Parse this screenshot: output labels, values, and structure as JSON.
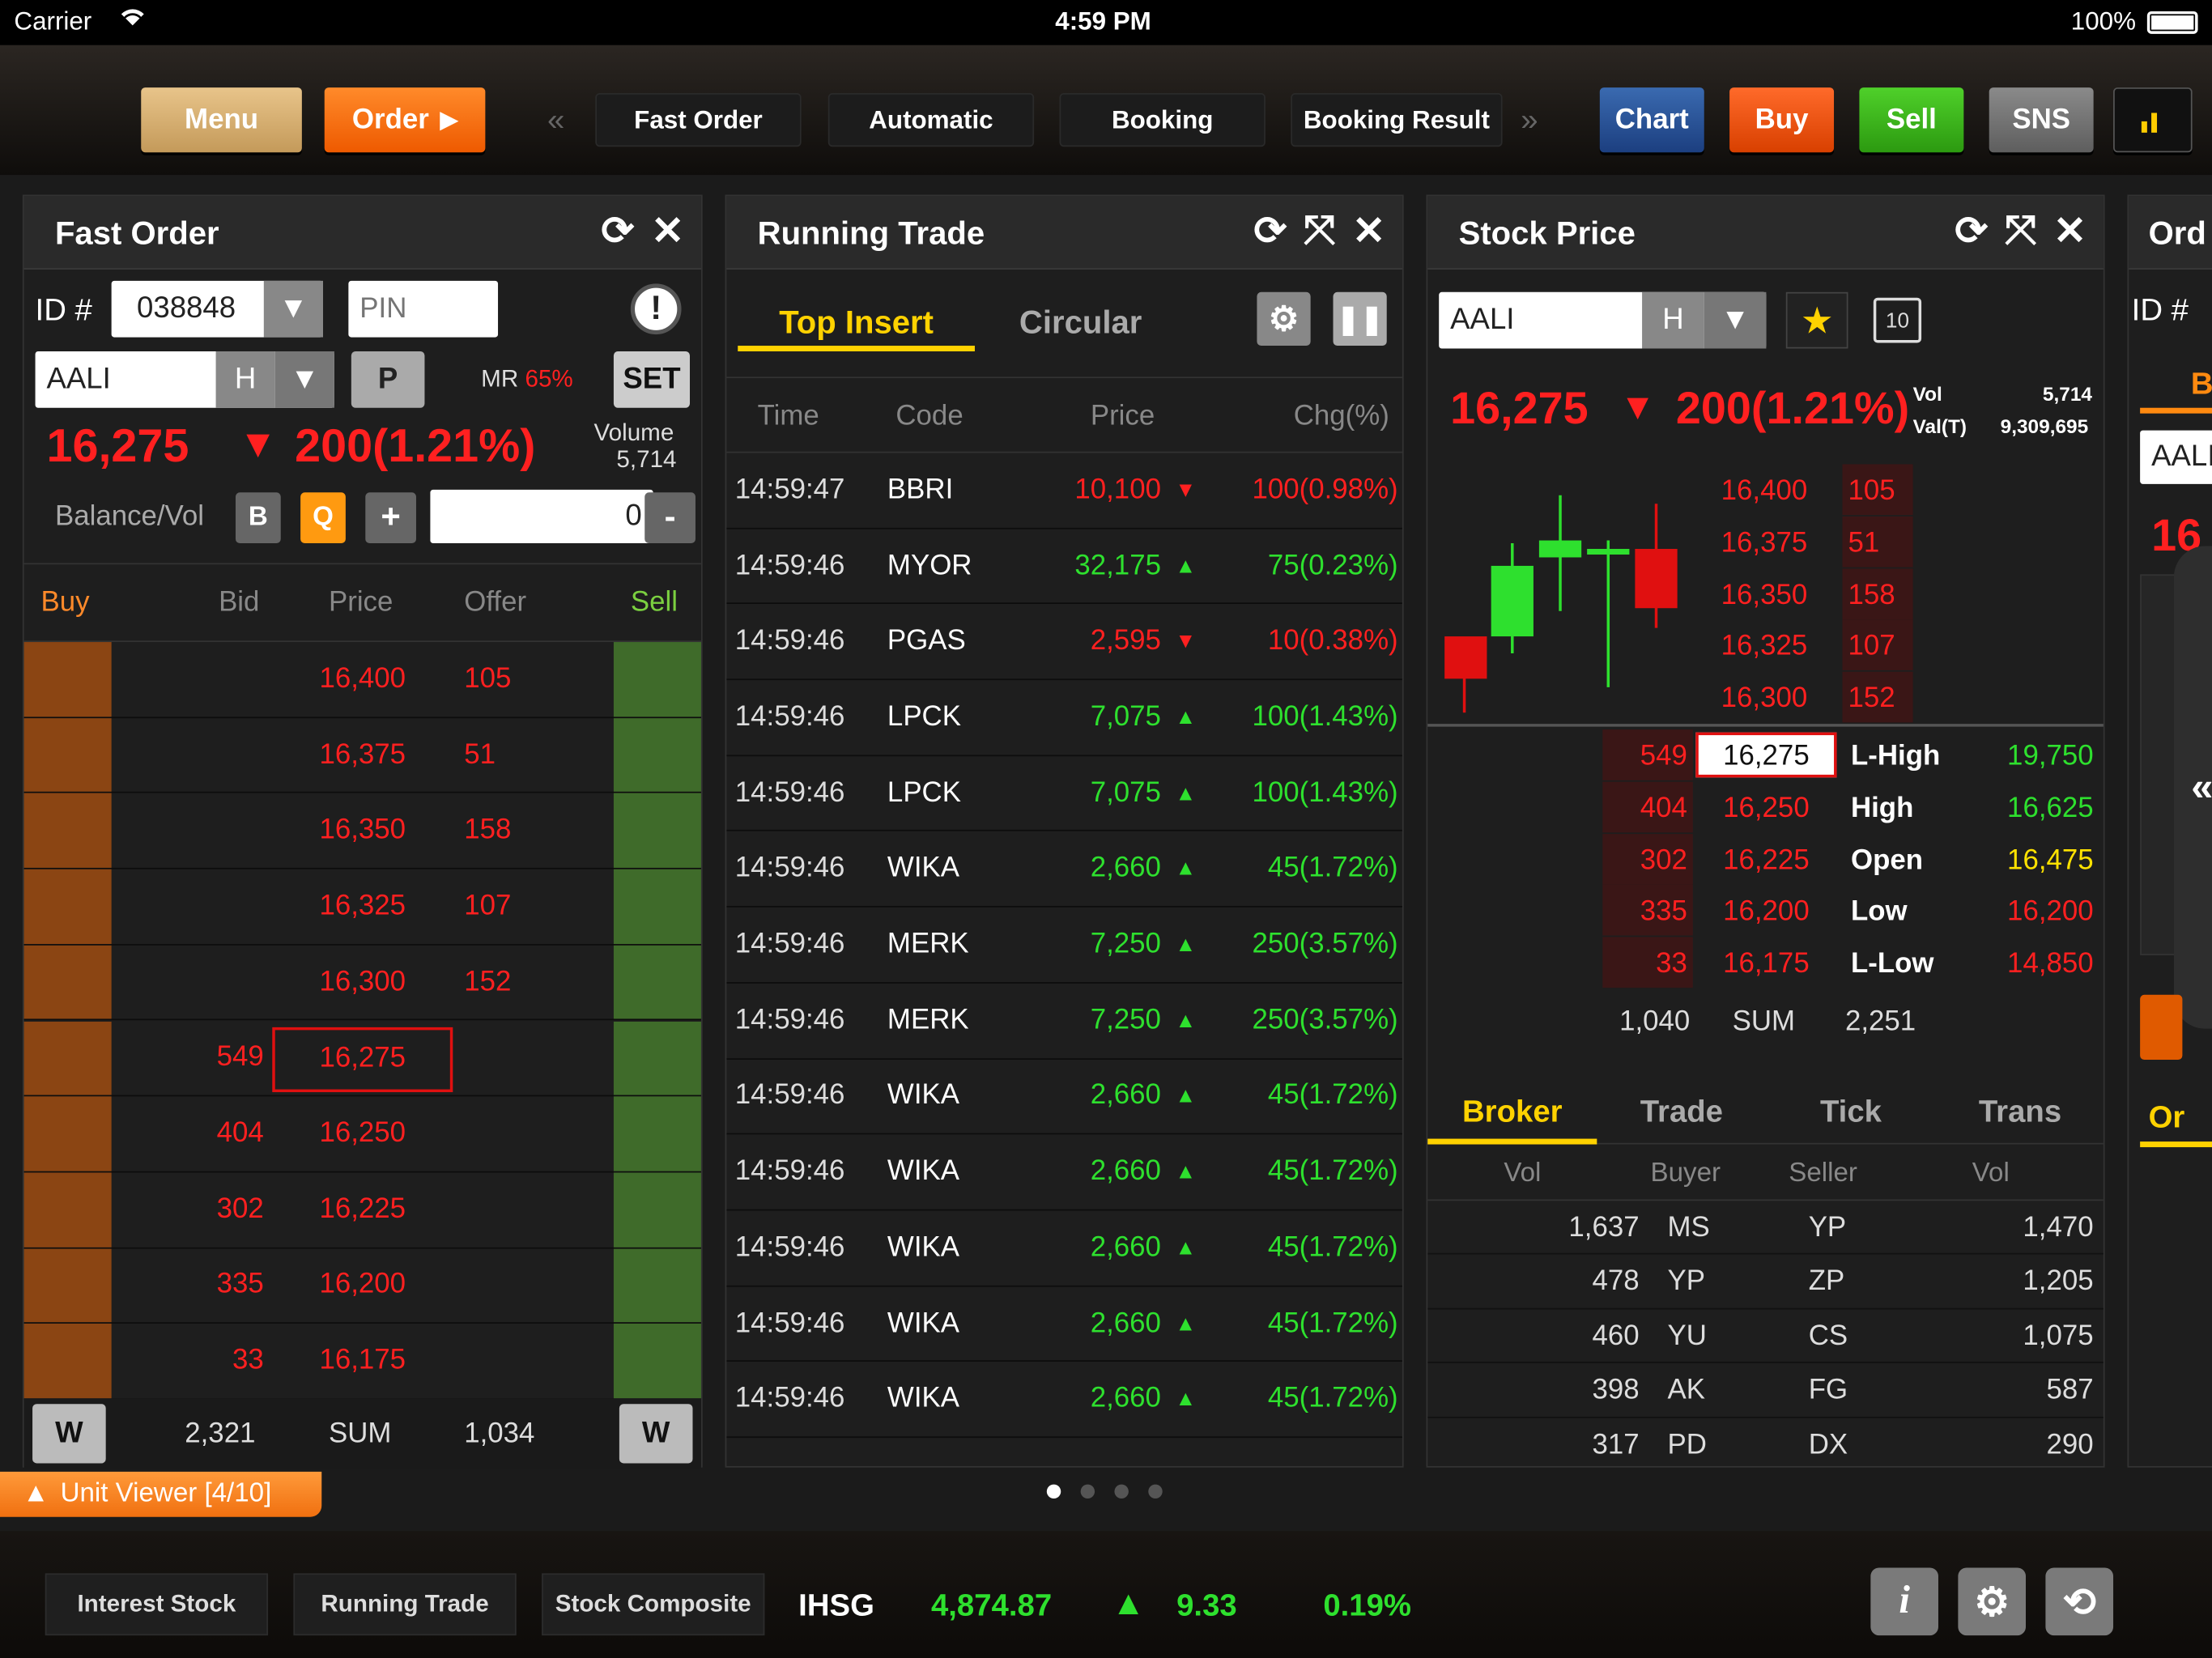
{
  "status": {
    "carrier": "Carrier",
    "time": "4:59 PM",
    "battery": "100%"
  },
  "nav": {
    "menu": "Menu",
    "order": "Order",
    "tabs": [
      "Fast Order",
      "Automatic",
      "Booking",
      "Booking Result"
    ],
    "chart": "Chart",
    "buy": "Buy",
    "sell": "Sell",
    "sns": "SNS"
  },
  "colors": {
    "accent": "#ff6600",
    "buy_bar": "#8b4513",
    "sell_bar": "#3f6b2a",
    "up": "#2ee02e",
    "down": "#ff2020"
  },
  "fast_order": {
    "title": "Fast Order",
    "id_label": "ID #",
    "id_value": "038848",
    "pin_placeholder": "PIN",
    "code": "AALI",
    "board": "H",
    "p_btn": "P",
    "mr_label": "MR",
    "mr_value": "65%",
    "set_btn": "SET",
    "price": "16,275",
    "change": "200(1.21%)",
    "volume_label": "Volume",
    "volume_value": "5,714",
    "balance_label": "Balance/Vol",
    "b_btn": "B",
    "q_btn": "Q",
    "plus": "+",
    "qty": "0",
    "minus": "-",
    "headers": {
      "buy": "Buy",
      "bid": "Bid",
      "price": "Price",
      "offer": "Offer",
      "sell": "Sell"
    },
    "rows": [
      {
        "bid": "",
        "price": "16,400",
        "offer": "105"
      },
      {
        "bid": "",
        "price": "16,375",
        "offer": "51"
      },
      {
        "bid": "",
        "price": "16,350",
        "offer": "158"
      },
      {
        "bid": "",
        "price": "16,325",
        "offer": "107"
      },
      {
        "bid": "",
        "price": "16,300",
        "offer": "152"
      },
      {
        "bid": "549",
        "price": "16,275",
        "offer": ""
      },
      {
        "bid": "404",
        "price": "16,250",
        "offer": ""
      },
      {
        "bid": "302",
        "price": "16,225",
        "offer": ""
      },
      {
        "bid": "335",
        "price": "16,200",
        "offer": ""
      },
      {
        "bid": "33",
        "price": "16,175",
        "offer": ""
      }
    ],
    "w_btn": "W",
    "sum_bid": "2,321",
    "sum_label": "SUM",
    "sum_offer": "1,034"
  },
  "running_trade": {
    "title": "Running Trade",
    "tab_top": "Top Insert",
    "tab_circular": "Circular",
    "headers": {
      "time": "Time",
      "code": "Code",
      "price": "Price",
      "chg": "Chg(%)"
    },
    "rows": [
      {
        "time": "14:59:47",
        "code": "BBRI",
        "price": "10,100",
        "chg": "100(0.98%)",
        "dir": "down"
      },
      {
        "time": "14:59:46",
        "code": "MYOR",
        "price": "32,175",
        "chg": "75(0.23%)",
        "dir": "up"
      },
      {
        "time": "14:59:46",
        "code": "PGAS",
        "price": "2,595",
        "chg": "10(0.38%)",
        "dir": "down"
      },
      {
        "time": "14:59:46",
        "code": "LPCK",
        "price": "7,075",
        "chg": "100(1.43%)",
        "dir": "up"
      },
      {
        "time": "14:59:46",
        "code": "LPCK",
        "price": "7,075",
        "chg": "100(1.43%)",
        "dir": "up"
      },
      {
        "time": "14:59:46",
        "code": "WIKA",
        "price": "2,660",
        "chg": "45(1.72%)",
        "dir": "up"
      },
      {
        "time": "14:59:46",
        "code": "MERK",
        "price": "7,250",
        "chg": "250(3.57%)",
        "dir": "up"
      },
      {
        "time": "14:59:46",
        "code": "MERK",
        "price": "7,250",
        "chg": "250(3.57%)",
        "dir": "up"
      },
      {
        "time": "14:59:46",
        "code": "WIKA",
        "price": "2,660",
        "chg": "45(1.72%)",
        "dir": "up"
      },
      {
        "time": "14:59:46",
        "code": "WIKA",
        "price": "2,660",
        "chg": "45(1.72%)",
        "dir": "up"
      },
      {
        "time": "14:59:46",
        "code": "WIKA",
        "price": "2,660",
        "chg": "45(1.72%)",
        "dir": "up"
      },
      {
        "time": "14:59:46",
        "code": "WIKA",
        "price": "2,660",
        "chg": "45(1.72%)",
        "dir": "up"
      },
      {
        "time": "14:59:46",
        "code": "WIKA",
        "price": "2,660",
        "chg": "45(1.72%)",
        "dir": "up"
      }
    ]
  },
  "stock_price": {
    "title": "Stock Price",
    "code": "AALI",
    "board": "H",
    "badge": "10",
    "price": "16,275",
    "change": "200(1.21%)",
    "vol_label": "Vol",
    "vol_value": "5,714",
    "valt_label": "Val(T)",
    "valt_value": "9,309,695",
    "offers": [
      {
        "price": "16,400",
        "vol": "105"
      },
      {
        "price": "16,375",
        "vol": "51"
      },
      {
        "price": "16,350",
        "vol": "158"
      },
      {
        "price": "16,325",
        "vol": "107"
      },
      {
        "price": "16,300",
        "vol": "152"
      }
    ],
    "bids": [
      {
        "vol": "549",
        "price": "16,275",
        "label": "L-High",
        "value": "19,750",
        "vcolor": "green"
      },
      {
        "vol": "404",
        "price": "16,250",
        "label": "High",
        "value": "16,625",
        "vcolor": "green"
      },
      {
        "vol": "302",
        "price": "16,225",
        "label": "Open",
        "value": "16,475",
        "vcolor": "yellow"
      },
      {
        "vol": "335",
        "price": "16,200",
        "label": "Low",
        "value": "16,200",
        "vcolor": "red"
      },
      {
        "vol": "33",
        "price": "16,175",
        "label": "L-Low",
        "value": "14,850",
        "vcolor": "red"
      }
    ],
    "sum_left": "1,040",
    "sum_label": "SUM",
    "sum_right": "2,251",
    "tabs": [
      "Broker",
      "Trade",
      "Tick",
      "Trans"
    ],
    "broker_headers": {
      "vol1": "Vol",
      "buyer": "Buyer",
      "seller": "Seller",
      "vol2": "Vol"
    },
    "broker_rows": [
      {
        "vol1": "1,637",
        "buyer": "MS",
        "seller": "YP",
        "vol2": "1,470"
      },
      {
        "vol1": "478",
        "buyer": "YP",
        "seller": "ZP",
        "vol2": "1,205"
      },
      {
        "vol1": "460",
        "buyer": "YU",
        "seller": "CS",
        "vol2": "1,075"
      },
      {
        "vol1": "398",
        "buyer": "AK",
        "seller": "FG",
        "vol2": "587"
      },
      {
        "vol1": "317",
        "buyer": "PD",
        "seller": "DX",
        "vol2": "290"
      }
    ]
  },
  "order_panel": {
    "title": "Ord",
    "id_label": "ID #",
    "tab_letter": "B",
    "code": "AALI",
    "price": "16",
    "tab": "Or"
  },
  "unit_viewer": "Unit Viewer [4/10]",
  "footer": {
    "tabs": [
      "Interest Stock",
      "Running Trade",
      "Stock Composite"
    ],
    "index_name": "IHSG",
    "index_value": "4,874.87",
    "index_change": "9.33",
    "index_pct": "0.19%"
  }
}
